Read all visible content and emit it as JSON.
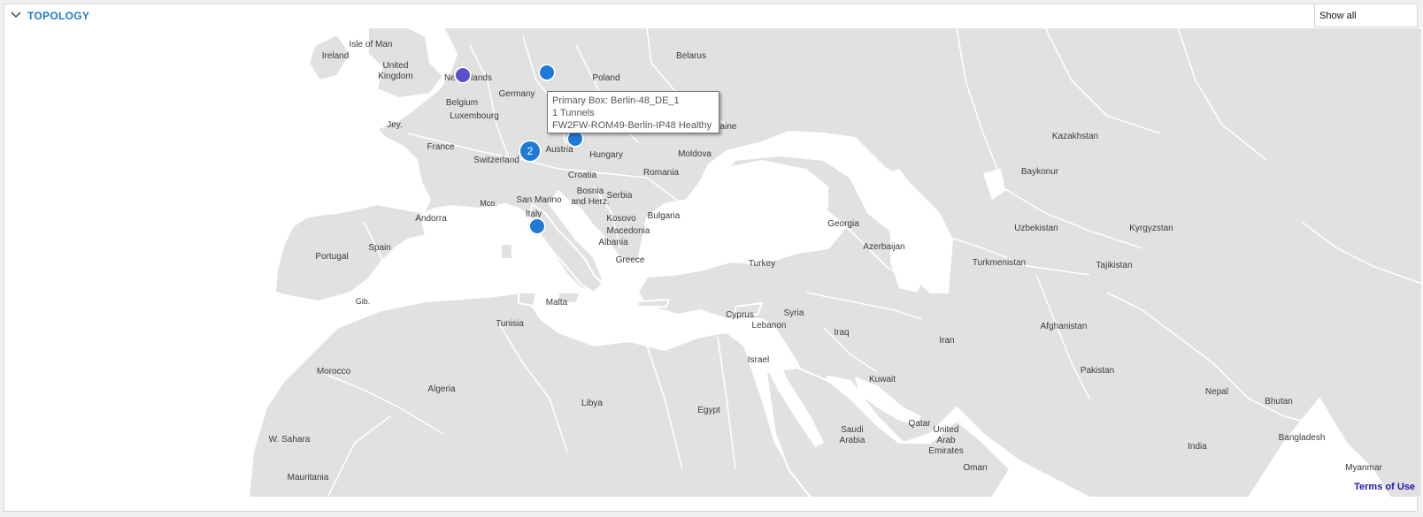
{
  "header": {
    "title": "TOPOLOGY",
    "filter_value": "Show all"
  },
  "colors": {
    "land": "#e1e1e1",
    "border": "#ffffff",
    "marker": "#1f7ad6",
    "marker_alt": "#5b4fcf"
  },
  "map": {
    "labels": [
      "Isle of Man",
      "Ireland",
      "United Kingdom",
      "Netherlands",
      "Belgium",
      "Luxembourg",
      "Germany",
      "Poland",
      "Belarus",
      "Jey.",
      "France",
      "Switzerland",
      "Austria",
      "Hungary",
      "Moldova",
      "Romania",
      "Croatia",
      "Bosnia and Herz.",
      "Serbia",
      "San Marino",
      "Mco.",
      "Italy",
      "Andorra",
      "Kosovo",
      "Bulgaria",
      "Macedonia",
      "Albania",
      "Greece",
      "Spain",
      "Portugal",
      "Gib.",
      "Malta",
      "Tunisia",
      "Morocco",
      "Algeria",
      "Libya",
      "Egypt",
      "W. Sahara",
      "Mauritania",
      "Turkey",
      "Georgia",
      "Azerbaijan",
      "Cyprus",
      "Lebanon",
      "Syria",
      "Iraq",
      "Israel",
      "Kuwait",
      "Saudi Arabia",
      "Qatar",
      "United Arab Emirates",
      "Oman",
      "Iran",
      "Turkmenistan",
      "Uzbekistan",
      "Kyrgyzstan",
      "Tajikistan",
      "Kazakhstan",
      "Baykonur",
      "Afghanistan",
      "Pakistan",
      "Nepal",
      "Bhutan",
      "India",
      "Bangladesh",
      "Myanmar",
      "aine"
    ],
    "markers": [
      {
        "type": "single",
        "color": "#5b4fcf"
      },
      {
        "type": "single",
        "color": "#1f7ad6"
      },
      {
        "type": "cluster",
        "count": "2",
        "color": "#1f7ad6"
      },
      {
        "type": "single",
        "color": "#1f7ad6"
      },
      {
        "type": "single",
        "color": "#1f7ad6"
      }
    ],
    "tooltip": {
      "line1": "Primary Box: Berlin-48_DE_1",
      "line2": "1 Tunnels",
      "line3": "FW2FW-ROM49-Berlin-IP48 Healthy"
    },
    "terms": "Terms of Use"
  }
}
